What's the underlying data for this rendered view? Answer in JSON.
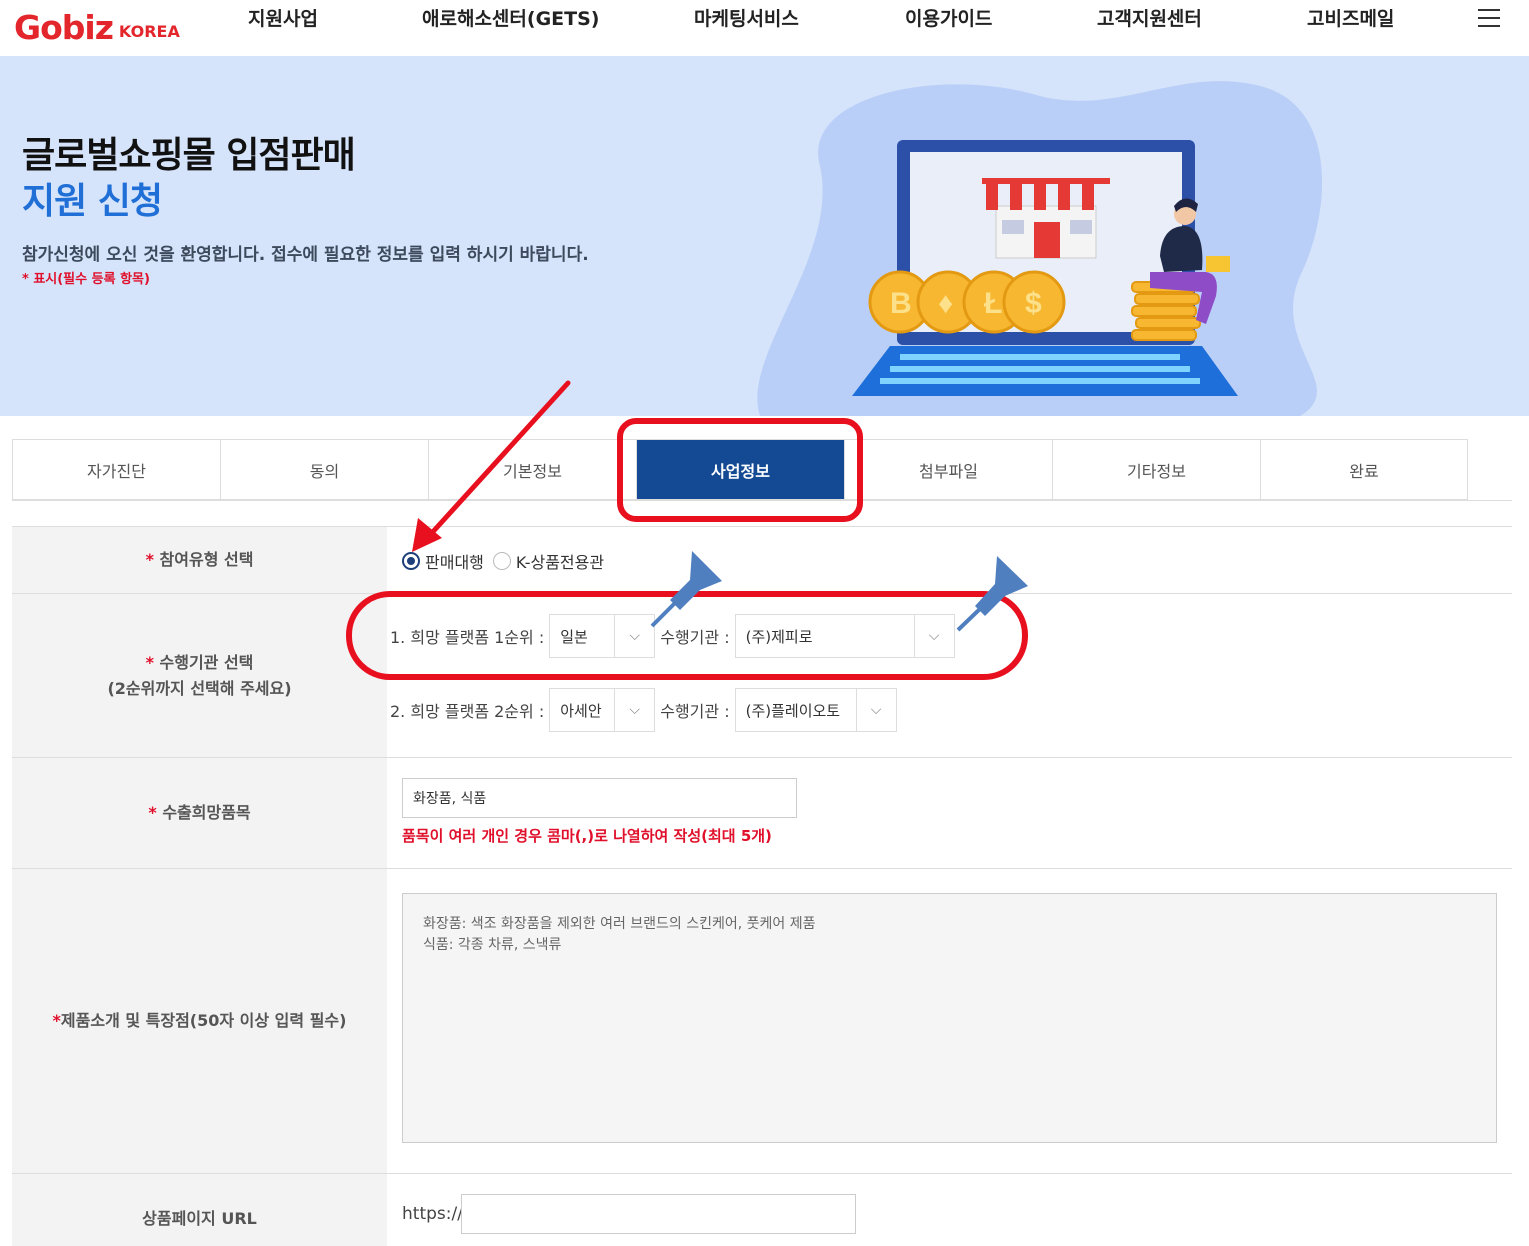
{
  "header": {
    "logo_main": "Gobiz",
    "logo_sub": "KOREA",
    "nav": [
      "지원사업",
      "애로해소센터(GETS)",
      "마케팅서비스",
      "이용가이드",
      "고객지원센터",
      "고비즈메일"
    ]
  },
  "hero": {
    "title_line1": "글로벌쇼핑몰 입점판매",
    "title_line2": "지원 신청",
    "description": "참가신청에 오신 것을 환영합니다. 접수에 필요한 정보를 입력 하시기 바랍니다.",
    "required_note": "* 표시(필수 등록 항목)"
  },
  "tabs": [
    {
      "label": "자가진단",
      "active": false
    },
    {
      "label": "동의",
      "active": false
    },
    {
      "label": "기본정보",
      "active": false
    },
    {
      "label": "사업정보",
      "active": true
    },
    {
      "label": "첨부파일",
      "active": false
    },
    {
      "label": "기타정보",
      "active": false
    },
    {
      "label": "완료",
      "active": false
    }
  ],
  "form": {
    "participation": {
      "req": "*",
      "label": "참여유형 선택",
      "options": [
        {
          "label": "판매대행",
          "selected": true
        },
        {
          "label": "K-상품전용관",
          "selected": false
        }
      ]
    },
    "agency": {
      "req": "*",
      "label": "수행기관 선택",
      "sublabel": "(2순위까지 선택해 주세요)",
      "priority1": {
        "label": "1. 희망 플랫폼 1순위 :",
        "platform": "일본",
        "agency_label": "수행기관 :",
        "agency": "(주)제피로"
      },
      "priority2": {
        "label": "2. 희망 플랫폼 2순위 :",
        "platform": "아세안",
        "agency_label": "수행기관 :",
        "agency": "(주)플레이오토"
      }
    },
    "export_items": {
      "req": "*",
      "label": "수출희망품목",
      "value": "화장품, 식품",
      "help": "품목이 여러 개인 경우 콤마(,)로 나열하여 작성(최대 5개)"
    },
    "product_intro": {
      "req": "*",
      "label": "제품소개 및 특장점(50자 이상 입력 필수)",
      "value": "화장품: 색조 화장품을 제외한 여러 브랜드의 스킨케어, 풋케어 제품\n식품: 각종 차류, 스낵류"
    },
    "product_url": {
      "label": "상품페이지 URL",
      "prefix": "https://",
      "value": ""
    }
  },
  "colors": {
    "brand_red": "#e3252c",
    "active_tab": "#134a93",
    "hero_bg": "#d5e3fb",
    "annotation_red": "#e8101e",
    "pin_blue": "#4f7fbf"
  }
}
